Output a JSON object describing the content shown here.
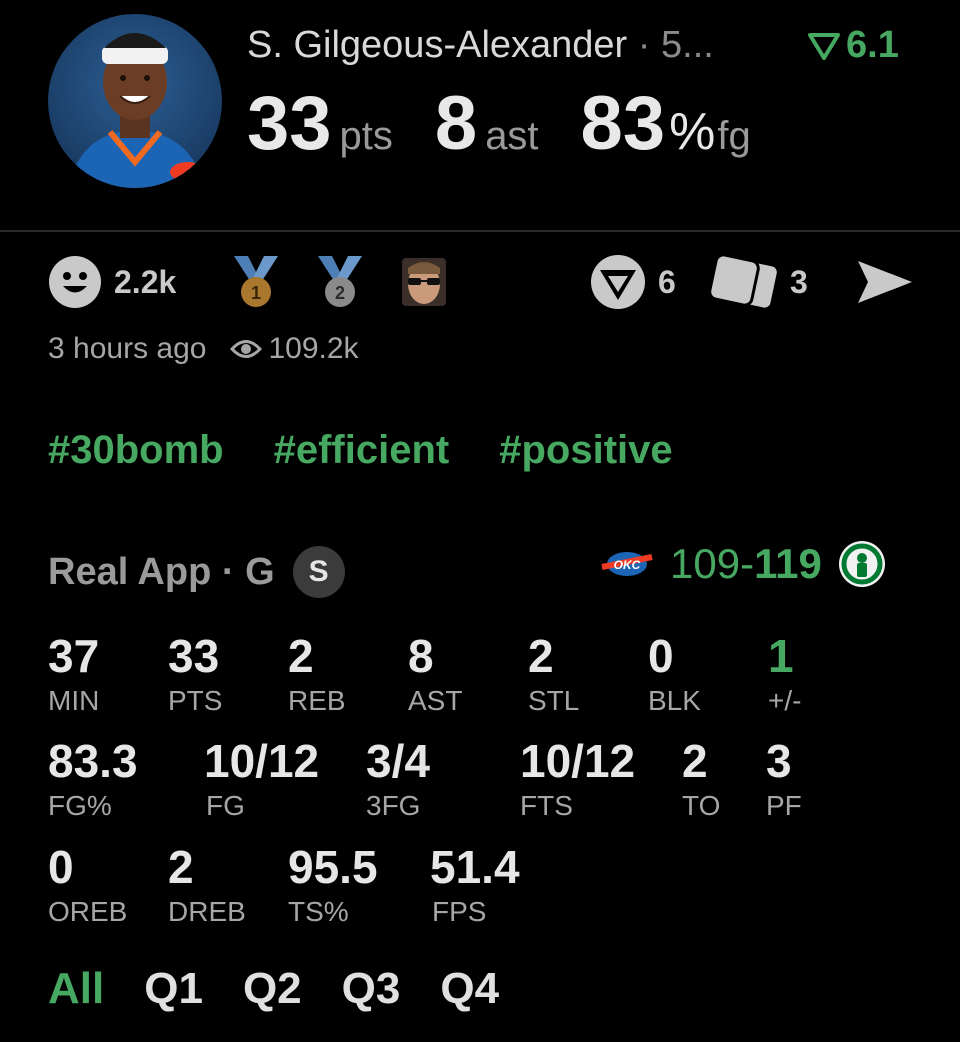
{
  "header": {
    "player_name": "S. Gilgeous-Alexander",
    "name_suffix": "5...",
    "rating": "6.1",
    "pts_value": "33",
    "pts_label": "pts",
    "ast_value": "8",
    "ast_label": "ast",
    "fg_value": "83",
    "fg_pct_sign": "%",
    "fg_label": "fg"
  },
  "reactions": {
    "smile_count": "2.2k",
    "comments_count": "6",
    "cards_count": "3"
  },
  "meta": {
    "time_ago": "3 hours ago",
    "views": "109.2k"
  },
  "tags": [
    "#30bomb",
    "#efficient",
    "#positive"
  ],
  "game": {
    "source": "Real App",
    "position": "G",
    "badge": "S",
    "score_left": "109",
    "score_dash": "-",
    "score_right": "119"
  },
  "stats": {
    "row1": [
      {
        "value": "37",
        "label": "MIN"
      },
      {
        "value": "33",
        "label": "PTS"
      },
      {
        "value": "2",
        "label": "REB"
      },
      {
        "value": "8",
        "label": "AST"
      },
      {
        "value": "2",
        "label": "STL"
      },
      {
        "value": "0",
        "label": "BLK"
      },
      {
        "value": "1",
        "label": "+/-"
      }
    ],
    "row2": [
      {
        "value": "83.3",
        "label": "FG%"
      },
      {
        "value": "10/12",
        "label": "FG"
      },
      {
        "value": "3/4",
        "label": "3FG"
      },
      {
        "value": "10/12",
        "label": "FTS"
      },
      {
        "value": "2",
        "label": "TO"
      },
      {
        "value": "3",
        "label": "PF"
      }
    ],
    "row3": [
      {
        "value": "0",
        "label": "OREB"
      },
      {
        "value": "2",
        "label": "DREB"
      },
      {
        "value": "95.5",
        "label": "TS%"
      },
      {
        "value": "51.4",
        "label": "FPS"
      }
    ]
  },
  "quarter_tabs": [
    "All",
    "Q1",
    "Q2",
    "Q3",
    "Q4"
  ],
  "colors": {
    "accent_green": "#46a861",
    "background": "#000000",
    "muted_text": "#a6a6a6"
  }
}
